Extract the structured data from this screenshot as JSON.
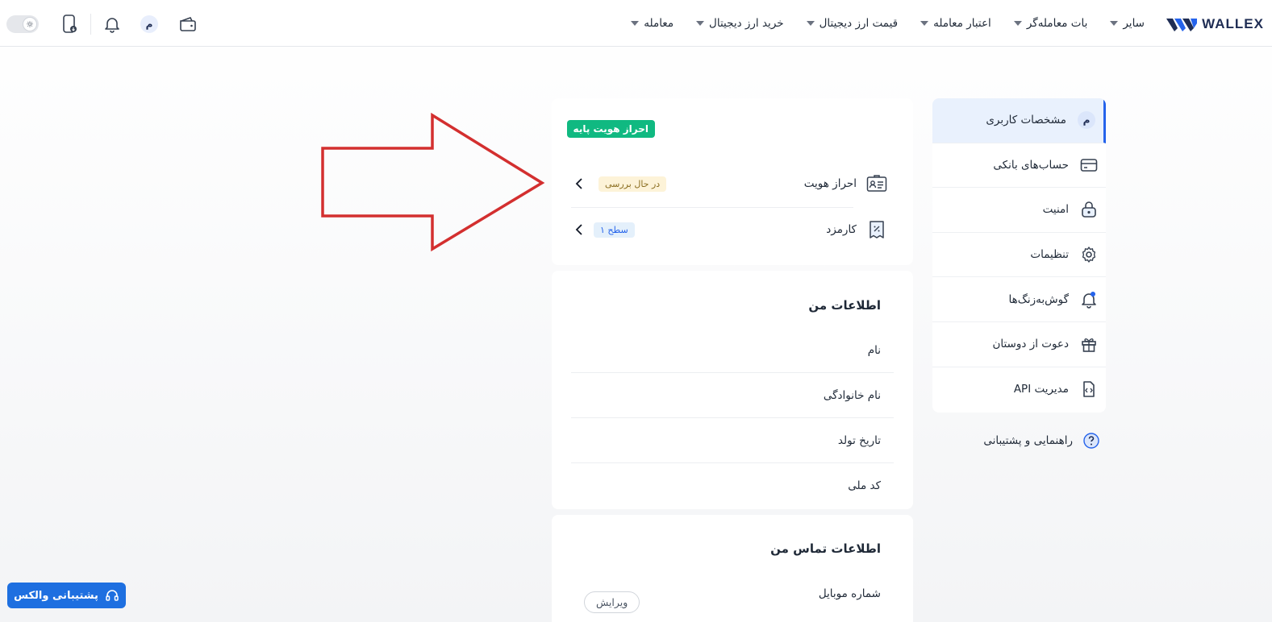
{
  "brand": {
    "name": "WALLEX"
  },
  "nav": {
    "items": [
      {
        "label": "معامله"
      },
      {
        "label": "خرید ارز دیجیتال"
      },
      {
        "label": "قیمت ارز دیجیتال"
      },
      {
        "label": "اعتبار معامله"
      },
      {
        "label": "بات معامله‌گر"
      },
      {
        "label": "سایر"
      }
    ]
  },
  "toolbar": {
    "avatar_letter": "م"
  },
  "sidebar": {
    "items": [
      {
        "label": "مشخصات کاربری",
        "icon": "user-badge-icon",
        "active": true
      },
      {
        "label": "حساب‌های بانکی",
        "icon": "credit-card-icon"
      },
      {
        "label": "امنیت",
        "icon": "lock-icon"
      },
      {
        "label": "تنظیمات",
        "icon": "gear-icon"
      },
      {
        "label": "گوش‌به‌زنگ‌ها",
        "icon": "bell-alert-icon"
      },
      {
        "label": "دعوت از دوستان",
        "icon": "gift-icon"
      },
      {
        "label": "مدیریت API",
        "icon": "code-file-icon"
      }
    ],
    "help": {
      "label": "راهنمایی و پشتیبانی",
      "icon": "question-icon"
    }
  },
  "identity_card": {
    "level_badge": "احراز هویت پایه",
    "identity_row": {
      "label": "احراز هویت",
      "status": "در حال بررسی"
    },
    "fee_row": {
      "label": "کارمزد",
      "level": "سطح ۱"
    }
  },
  "my_info": {
    "title": "اطلاعات من",
    "fields": [
      {
        "label": "نام"
      },
      {
        "label": "نام خانوادگی"
      },
      {
        "label": "تاریخ تولد"
      },
      {
        "label": "کد ملی"
      }
    ]
  },
  "contact_info": {
    "title": "اطلاعات تماس من",
    "mobile_label": "شماره موبایل",
    "edit_label": "ویرایش"
  },
  "support_button": {
    "label": "پشتیبانی والکس"
  },
  "colors": {
    "accent": "#2563eb",
    "success": "#10b981",
    "annotation_arrow": "#d32f2f",
    "support": "#1e6fe0"
  }
}
